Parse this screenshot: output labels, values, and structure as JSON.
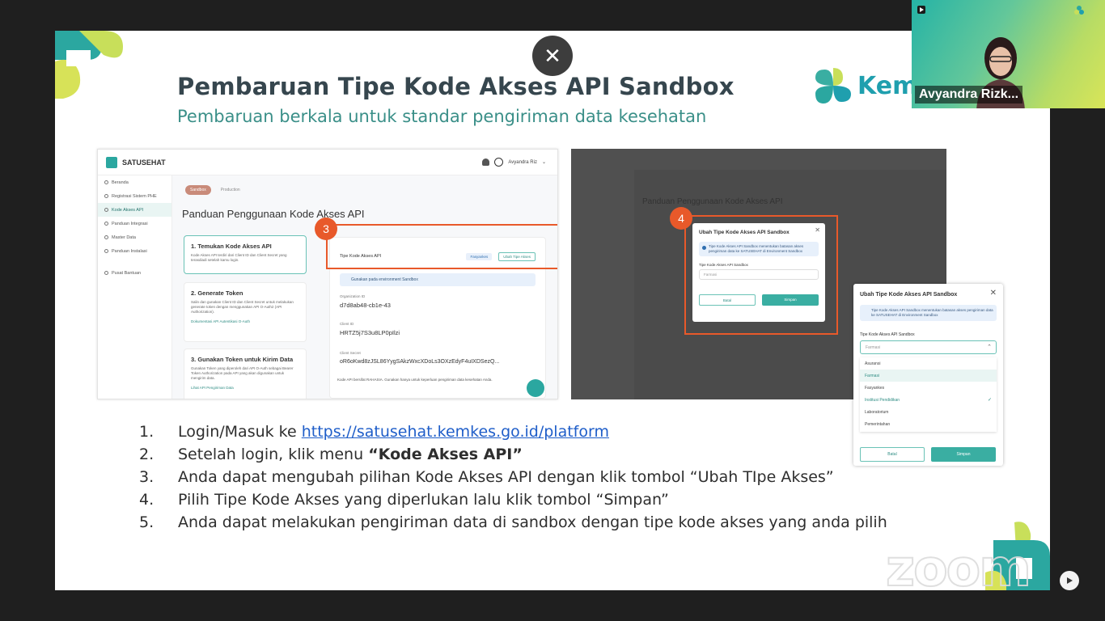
{
  "slide": {
    "title": "Pembaruan Tipe Kode Akses API Sandbox",
    "subtitle": "Pembaruan berkala untuk standar pengiriman data kesehatan",
    "brand_text": "Kem",
    "brand_color": "#1f9fae",
    "title_color": "#36464e",
    "subtitle_color": "#3a8f88"
  },
  "close_button": {
    "icon": "close-icon",
    "glyph": "✕"
  },
  "app": {
    "logo": "SATUSEHAT",
    "user": "Avyandra Riz",
    "sidebar": [
      "Beranda",
      "Registrasi Sistem PHE",
      "Kode Akses API",
      "Panduan Integrasi",
      "Master Data",
      "Panduan Instalasi",
      "Pusat Bantuan"
    ],
    "tabs": [
      "Sandbox",
      "Production"
    ],
    "heading": "Panduan Penggunaan Kode Akses API",
    "cards": [
      {
        "title": "1. Temukan Kode Akses API",
        "desc": "Kode Akses API terdiri dari Client ID dan Client Secret yang terasdiadi setelah kamu login.",
        "link": ""
      },
      {
        "title": "2. Generate Token",
        "desc": "Salin dan gunakan Client ID dan Client Secret untuk melakukan generate token dengan menggunakan API O-Auth2 (API Authorization).",
        "link": "Dokumentasi API Autentikasi O-Auth"
      },
      {
        "title": "3. Gunakan Token untuk Kirim Data",
        "desc": "Gunakan Token yang diperoleh dari API O-Auth sebagai Bearer Token Authorization pada API yang akan digunakan untuk mengirim data.",
        "link": "Lihat API Pengiriman Data"
      }
    ],
    "panel": {
      "row_label": "Tipe Kode Akses API",
      "row_value": "Fasyankes",
      "change_button": "Ubah Tipe Akses",
      "info": "Gunakan pada environment Sandbox",
      "org_label": "Organization ID",
      "org_value": "d7d8ab48-cb1e-43",
      "client_id_label": "Client ID",
      "client_id_value": "HRTZ5j7S3u8LP0pIlzi",
      "client_secret_label": "Client Secret",
      "client_secret_value": "oR6oKwd8zJSL86YygSAkzWxcXDoLs3OXzEdyF4uIXDSezQ...",
      "footer": "Kode API bersifat RAHASIA. Gunakan hanya untuk keperluan pengiriman data kesehatan Anda."
    },
    "badge_3": "3"
  },
  "app2": {
    "heading": "Panduan Penggunaan Kode Akses API",
    "badge_4": "4",
    "modal": {
      "title": "Ubah Tipe Kode Akses API Sandbox",
      "info": "Tipe Kode Akses API Sandbox menentukan batasan akses pengiriman data ke SATUSEHAT di Environment Sandbox",
      "field_label": "Tipe Kode Akses API Sandbox",
      "field_value": "Farmasi",
      "cancel": "Batal",
      "save": "Simpan"
    }
  },
  "big_modal": {
    "title": "Ubah Tipe Kode Akses API Sandbox",
    "info": "Tipe Kode Akses API Sandbox menentukan batasan akses pengiriman data ke SATUSEHAT di Environment Sandbox",
    "field_label": "Tipe Kode Akses API Sandbox",
    "placeholder": "Farmasi",
    "options": [
      "Asuransi",
      "Farmasi",
      "Fasyankes",
      "Institusi Pendidikan",
      "Laboratorium",
      "Pemerintahan"
    ],
    "selected_index": 1,
    "checked_index": 3,
    "cancel": "Batal",
    "save": "Simpan"
  },
  "steps": [
    {
      "num": "1.",
      "pre": "Login/Masuk ke ",
      "link": "https://satusehat.kemkes.go.id/platform"
    },
    {
      "num": "2.",
      "pre": "Setelah login, klik menu ",
      "bold": "“Kode Akses API”"
    },
    {
      "num": "3.",
      "text": "Anda dapat mengubah pilihan Kode Akses API dengan klik tombol “Ubah TIpe Akses”"
    },
    {
      "num": "4.",
      "text": "Pilih Tipe Kode Akses yang diperlukan lalu klik tombol “Simpan”"
    },
    {
      "num": "5.",
      "text": "Anda dapat melakukan pengiriman data di sandbox dengan tipe kode akses yang anda pilih"
    }
  ],
  "zoom_watermark": "zoom",
  "video": {
    "name": "Avyandra Rizk..."
  }
}
